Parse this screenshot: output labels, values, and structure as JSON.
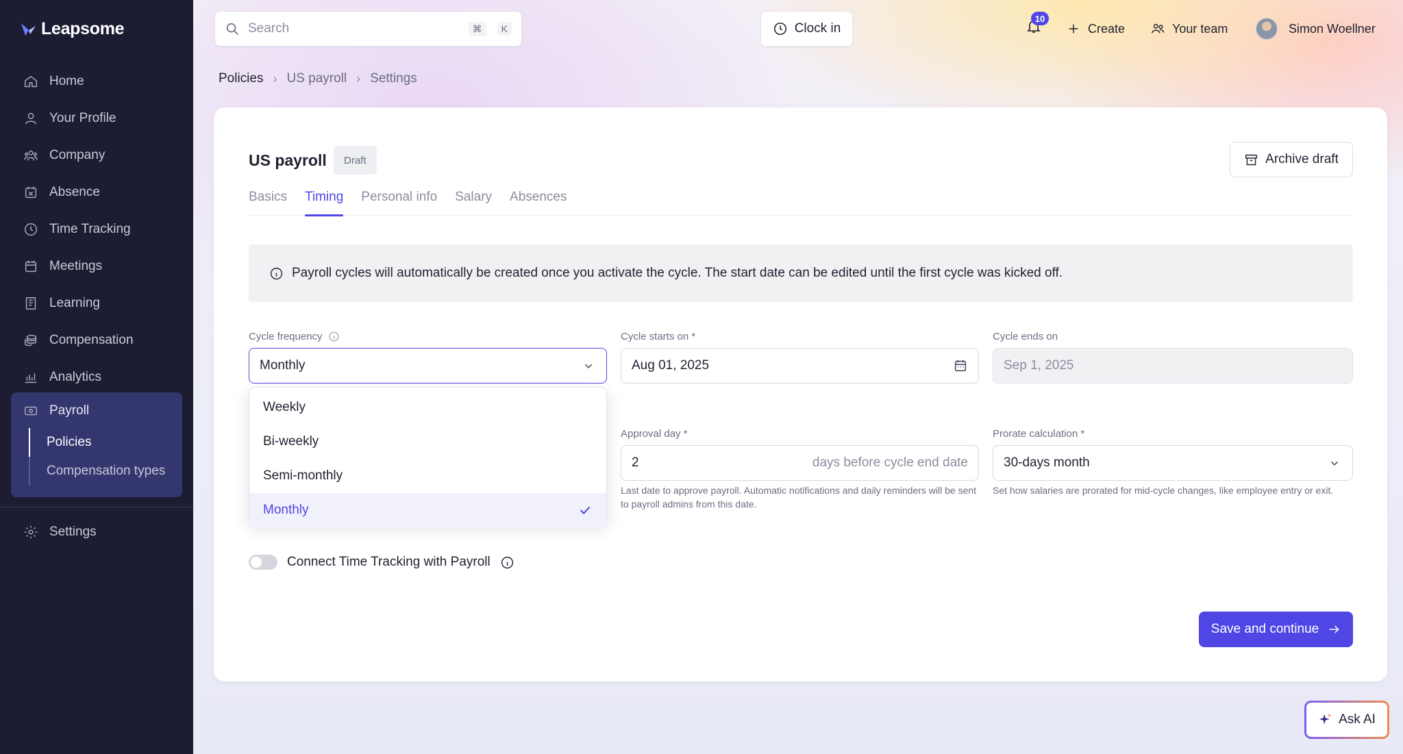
{
  "app": {
    "brand": "Leapsome",
    "accent": "#4f46e5"
  },
  "sidebar": {
    "items": [
      {
        "label": "Home",
        "icon": "home-icon"
      },
      {
        "label": "Your Profile",
        "icon": "user-icon"
      },
      {
        "label": "Company",
        "icon": "company-icon"
      },
      {
        "label": "Absence",
        "icon": "absence-calendar-icon"
      },
      {
        "label": "Time Tracking",
        "icon": "clock-icon"
      },
      {
        "label": "Meetings",
        "icon": "meetings-calendar-icon"
      },
      {
        "label": "Learning",
        "icon": "book-icon"
      },
      {
        "label": "Compensation",
        "icon": "coins-icon"
      },
      {
        "label": "Analytics",
        "icon": "chart-icon"
      }
    ],
    "payroll": {
      "label": "Payroll",
      "icon": "payroll-money-icon",
      "subitems": [
        {
          "label": "Policies",
          "active": true
        },
        {
          "label": "Compensation types",
          "active": false
        }
      ]
    },
    "settings": {
      "label": "Settings",
      "icon": "gear-icon"
    }
  },
  "topbar": {
    "search_placeholder": "Search",
    "shortcut_cmd": "⌘",
    "shortcut_key": "K",
    "clock_in": "Clock in",
    "notifications_count": "10",
    "create": "Create",
    "your_team": "Your team",
    "user_name": "Simon Woellner"
  },
  "breadcrumb": [
    "Policies",
    "US payroll",
    "Settings"
  ],
  "page": {
    "title": "US payroll",
    "status": "Draft",
    "archive_label": "Archive draft",
    "tabs": [
      {
        "label": "Basics",
        "active": false
      },
      {
        "label": "Timing",
        "active": true
      },
      {
        "label": "Personal info",
        "active": false
      },
      {
        "label": "Salary",
        "active": false
      },
      {
        "label": "Absences",
        "active": false
      }
    ],
    "info_text": "Payroll cycles will automatically be created once you activate the cycle. The start date can be edited until the first cycle was kicked off."
  },
  "form": {
    "cycle_frequency": {
      "label": "Cycle frequency",
      "value": "Monthly",
      "options": [
        "Weekly",
        "Bi-weekly",
        "Semi-monthly",
        "Monthly"
      ],
      "selected_index": 3
    },
    "cycle_starts": {
      "label": "Cycle starts on *",
      "value": "Aug 01, 2025"
    },
    "cycle_ends": {
      "label": "Cycle ends on",
      "value": "Sep 1, 2025"
    },
    "approval_day": {
      "label": "Approval day *",
      "value": "2",
      "suffix": "days before cycle end date",
      "help": "Last date to approve payroll. Automatic notifications and daily reminders will be sent to payroll admins from this date."
    },
    "prorate": {
      "label": "Prorate calculation *",
      "value": "30-days month",
      "help": "Set how salaries are prorated for mid-cycle changes, like employee entry or exit."
    },
    "connect_time_tracking": {
      "label": "Connect Time Tracking with Payroll",
      "enabled": false
    },
    "save_label": "Save and continue"
  },
  "ask_ai": "Ask AI"
}
